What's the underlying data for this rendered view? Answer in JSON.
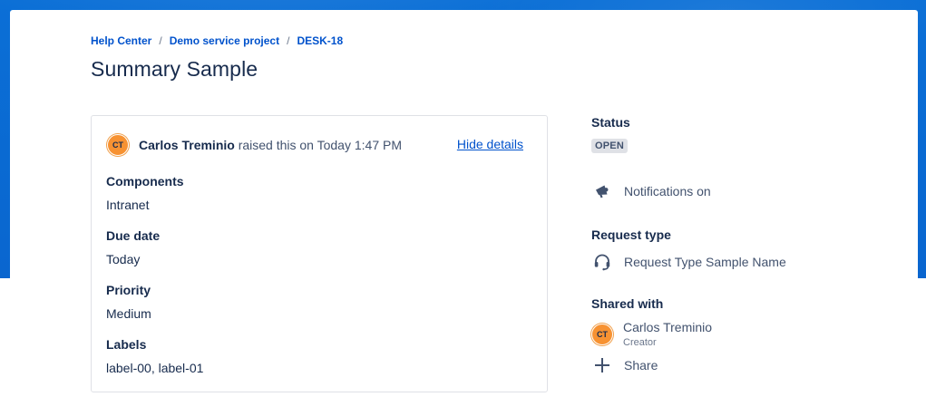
{
  "breadcrumb": {
    "items": [
      "Help Center",
      "Demo service project",
      "DESK-18"
    ],
    "separator": "/"
  },
  "page_title": "Summary Sample",
  "request_details": {
    "reporter_initials": "CT",
    "reporter_name": "Carlos Treminio",
    "raised_text": "raised this on Today 1:47 PM",
    "hide_details_label": "Hide details",
    "fields": [
      {
        "label": "Components",
        "value": "Intranet"
      },
      {
        "label": "Due date",
        "value": "Today"
      },
      {
        "label": "Priority",
        "value": "Medium"
      },
      {
        "label": "Labels",
        "value": "label-00, label-01"
      }
    ]
  },
  "sidebar": {
    "status_label": "Status",
    "status_value": "OPEN",
    "notifications_label": "Notifications on",
    "request_type_label": "Request type",
    "request_type_value": "Request Type Sample Name",
    "shared_with_label": "Shared with",
    "shared_person": {
      "initials": "CT",
      "name": "Carlos Treminio",
      "role": "Creator"
    },
    "share_label": "Share"
  },
  "colors": {
    "header_blue": "#0b6fd6",
    "link_blue": "#0052cc",
    "avatar_orange": "#f79232",
    "text_dark": "#172b4d",
    "badge_bg": "#dfe1e6"
  },
  "icons": {
    "notifications": "megaphone-icon",
    "request_type": "headset-icon",
    "share": "plus-icon"
  }
}
